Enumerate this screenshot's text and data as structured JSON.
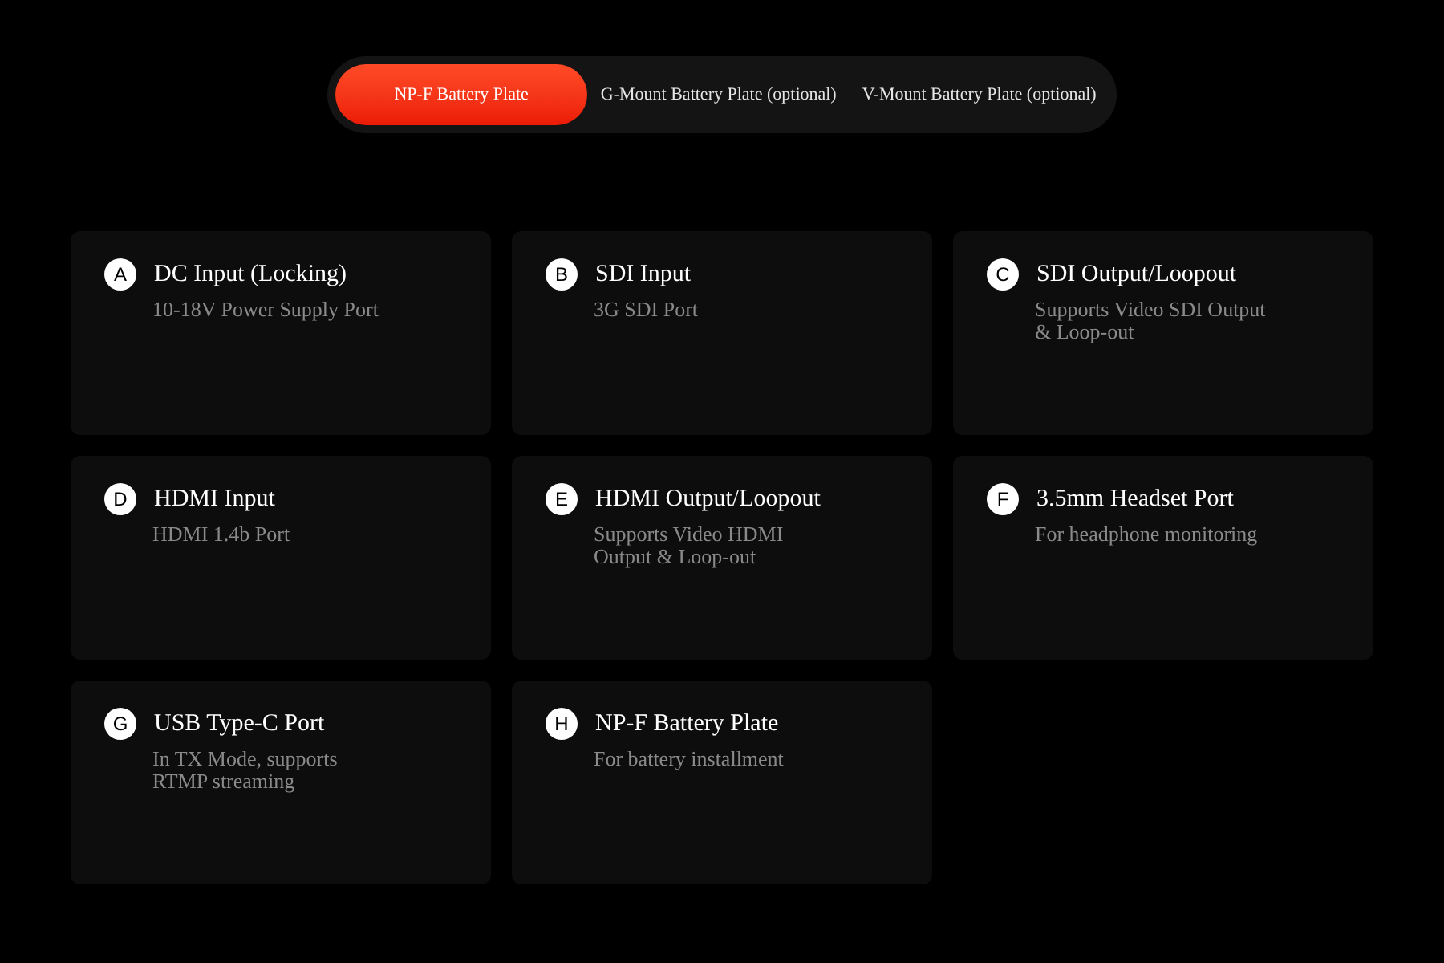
{
  "tabs": [
    {
      "label": "NP-F Battery Plate",
      "selected": true
    },
    {
      "label": "G-Mount Battery Plate (optional)",
      "selected": false
    },
    {
      "label": "V-Mount Battery Plate (optional)",
      "selected": false
    }
  ],
  "ports": [
    {
      "letter": "A",
      "title": "DC Input (Locking)",
      "description": "10-18V Power Supply Port"
    },
    {
      "letter": "B",
      "title": "SDI Input",
      "description": "3G SDI Port"
    },
    {
      "letter": "C",
      "title": "SDI Output/Loopout",
      "description": "Supports Video SDI Output & Loop-out"
    },
    {
      "letter": "D",
      "title": "HDMI Input",
      "description": "HDMI 1.4b Port"
    },
    {
      "letter": "E",
      "title": "HDMI Output/Loopout",
      "description": "Supports Video HDMI Output & Loop-out"
    },
    {
      "letter": "F",
      "title": "3.5mm Headset Port",
      "description": "For headphone monitoring"
    },
    {
      "letter": "G",
      "title": "USB Type-C Port",
      "description": "In TX Mode, supports RTMP streaming"
    },
    {
      "letter": "H",
      "title": "NP-F Battery Plate",
      "description": "For battery installment"
    }
  ]
}
